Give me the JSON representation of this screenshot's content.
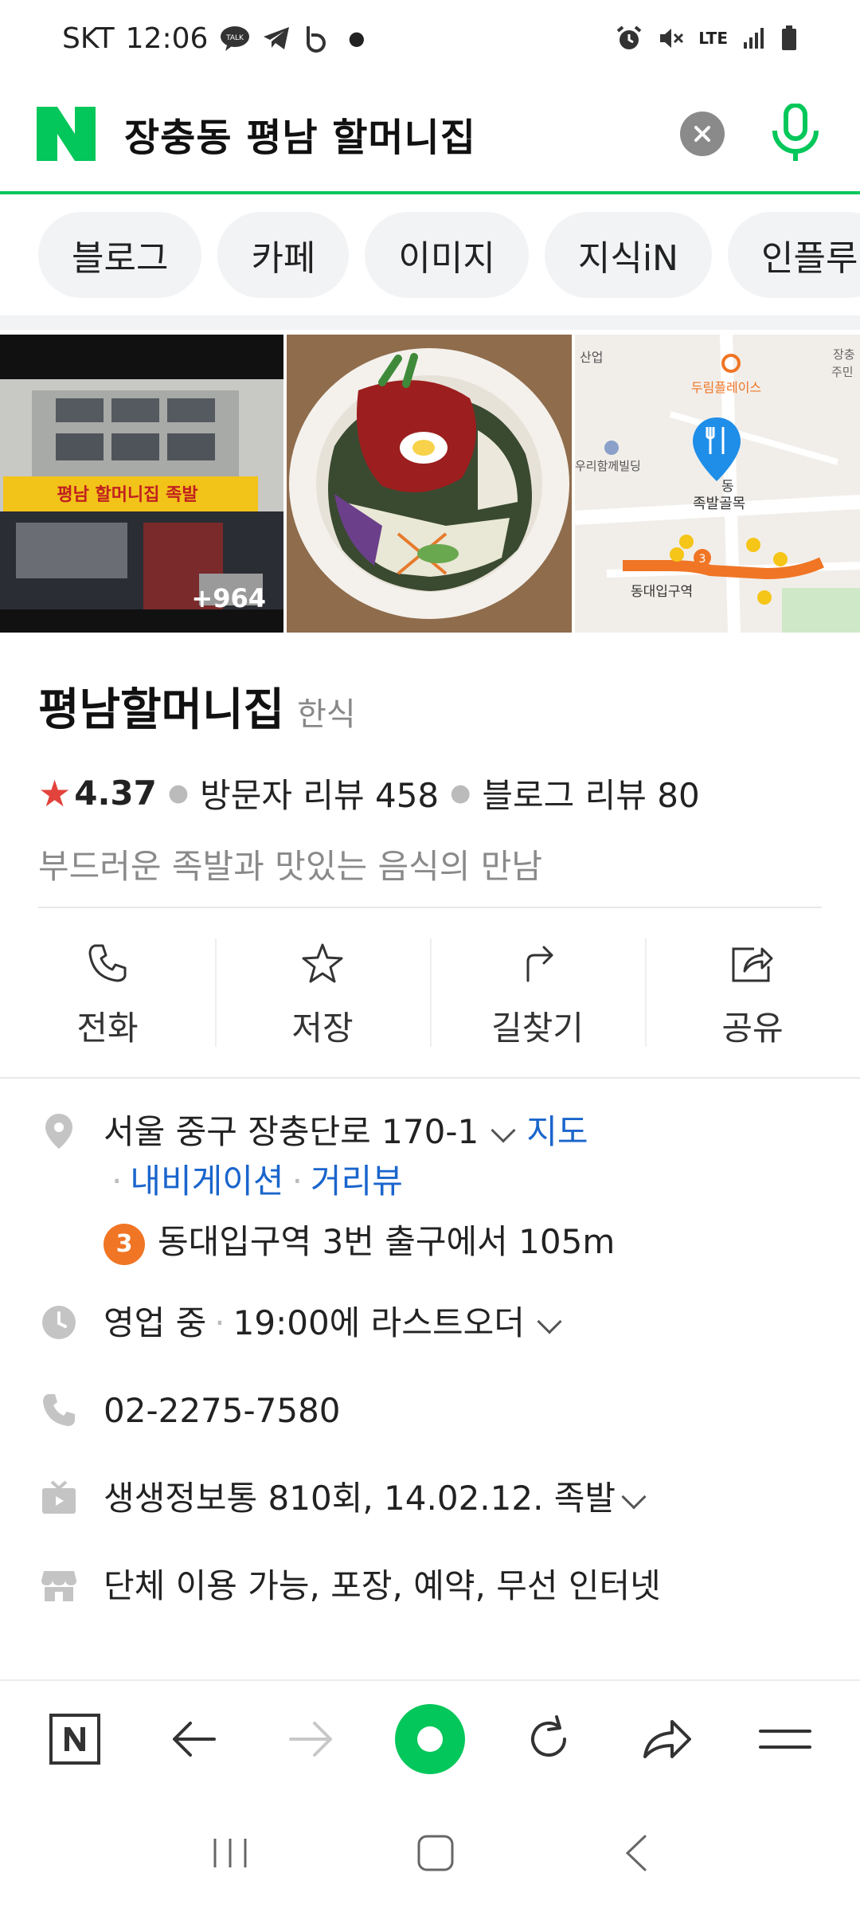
{
  "status_bar": {
    "carrier": "SKT",
    "time": "12:06",
    "network": "LTE"
  },
  "search": {
    "query": "장충동 평남 할머니집"
  },
  "tabs": [
    {
      "label": "블로그"
    },
    {
      "label": "카페"
    },
    {
      "label": "이미지"
    },
    {
      "label": "지식iN"
    },
    {
      "label": "인플루"
    }
  ],
  "photos": {
    "count_label": "+964",
    "sign_text": "평남 할머니집 족발",
    "map_labels": {
      "a": "산업",
      "b": "두림플레이스",
      "c": "장충\n주민",
      "d": "우리함께빌딩",
      "e": "족발골목",
      "f": "동대입구역"
    }
  },
  "place": {
    "name": "평남할머니집",
    "category": "한식",
    "rating": "4.37",
    "visitor_reviews": "방문자 리뷰 458",
    "blog_reviews": "블로그 리뷰 80",
    "description": "부드러운 족발과 맛있는 음식의 만남"
  },
  "actions": [
    {
      "label": "전화",
      "icon": "phone-icon"
    },
    {
      "label": "저장",
      "icon": "star-icon"
    },
    {
      "label": "길찾기",
      "icon": "directions-icon"
    },
    {
      "label": "공유",
      "icon": "share-icon"
    }
  ],
  "details": {
    "address": "서울 중구 장충단로 170-1",
    "map_link": "지도",
    "navigation_link": "내비게이션",
    "street_view_link": "거리뷰",
    "subway_line": "3",
    "subway_text": "동대입구역 3번 출구에서 105m",
    "hours_status": "영업 중",
    "hours_detail": "19:00에 라스트오더",
    "phone": "02-2275-7580",
    "tv": "생생정보통 810회, 14.02.12. 족발",
    "amenities": "단체 이용 가능, 포장, 예약, 무선 인터넷"
  },
  "colors": {
    "naver_green": "#03c75a",
    "link_blue": "#1a65cc",
    "star_red": "#e2433c",
    "subway_orange": "#f07524"
  }
}
